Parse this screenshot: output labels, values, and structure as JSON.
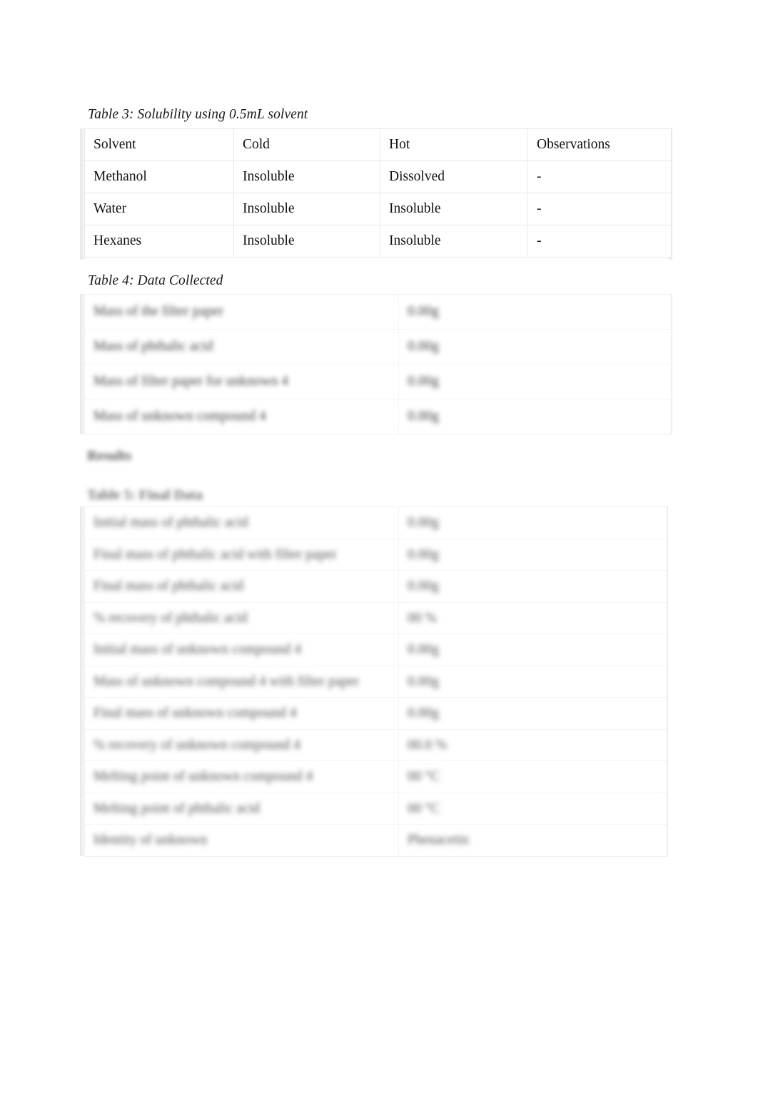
{
  "document": {
    "kind": "lab-report-page",
    "page_background": "#ffffff"
  },
  "table3": {
    "caption": "Table 3: Solubility using 0.5mL solvent",
    "columns": [
      "Solvent",
      "Cold",
      "Hot",
      "Observations"
    ],
    "rows": [
      [
        "Methanol",
        "Insoluble",
        "Dissolved",
        "-"
      ],
      [
        "Water",
        "Insoluble",
        "Insoluble",
        "-"
      ],
      [
        "Hexanes",
        "Insoluble",
        "Insoluble",
        "-"
      ]
    ]
  },
  "table4": {
    "caption": "Table 4: Data Collected",
    "redacted": true,
    "rows": [
      {
        "label": "Mass of the filter paper",
        "value": "0.00g"
      },
      {
        "label": "Mass of phthalic acid",
        "value": "0.00g"
      },
      {
        "label": "Mass of filter paper for unknown 4",
        "value": "0.00g"
      },
      {
        "label": "Mass of unknown compound 4",
        "value": "0.00g"
      }
    ]
  },
  "results": {
    "heading": "Results",
    "redacted": true
  },
  "table5": {
    "caption": "Table 5: Final Data",
    "redacted": true,
    "rows": [
      {
        "label": "Initial mass of phthalic acid",
        "value": "0.00g"
      },
      {
        "label": "Final mass of phthalic acid with filter paper",
        "value": "0.00g"
      },
      {
        "label": "Final mass of phthalic acid",
        "value": "0.00g"
      },
      {
        "label": "% recovery of phthalic acid",
        "value": "00 %"
      },
      {
        "label": "Initial mass of unknown compound 4",
        "value": "0.00g"
      },
      {
        "label": "Mass of unknown compound 4 with filter paper",
        "value": "0.00g"
      },
      {
        "label": "Final mass of unknown compound 4",
        "value": "0.00g"
      },
      {
        "label": "% recovery of unknown compound 4",
        "value": "00.0 %"
      },
      {
        "label": "Melting point of unknown compound 4",
        "value": "00 °C"
      },
      {
        "label": "Melting point of phthalic acid",
        "value": "00 °C"
      },
      {
        "label": "Identity of unknown",
        "value": "Phenacetin"
      }
    ]
  }
}
